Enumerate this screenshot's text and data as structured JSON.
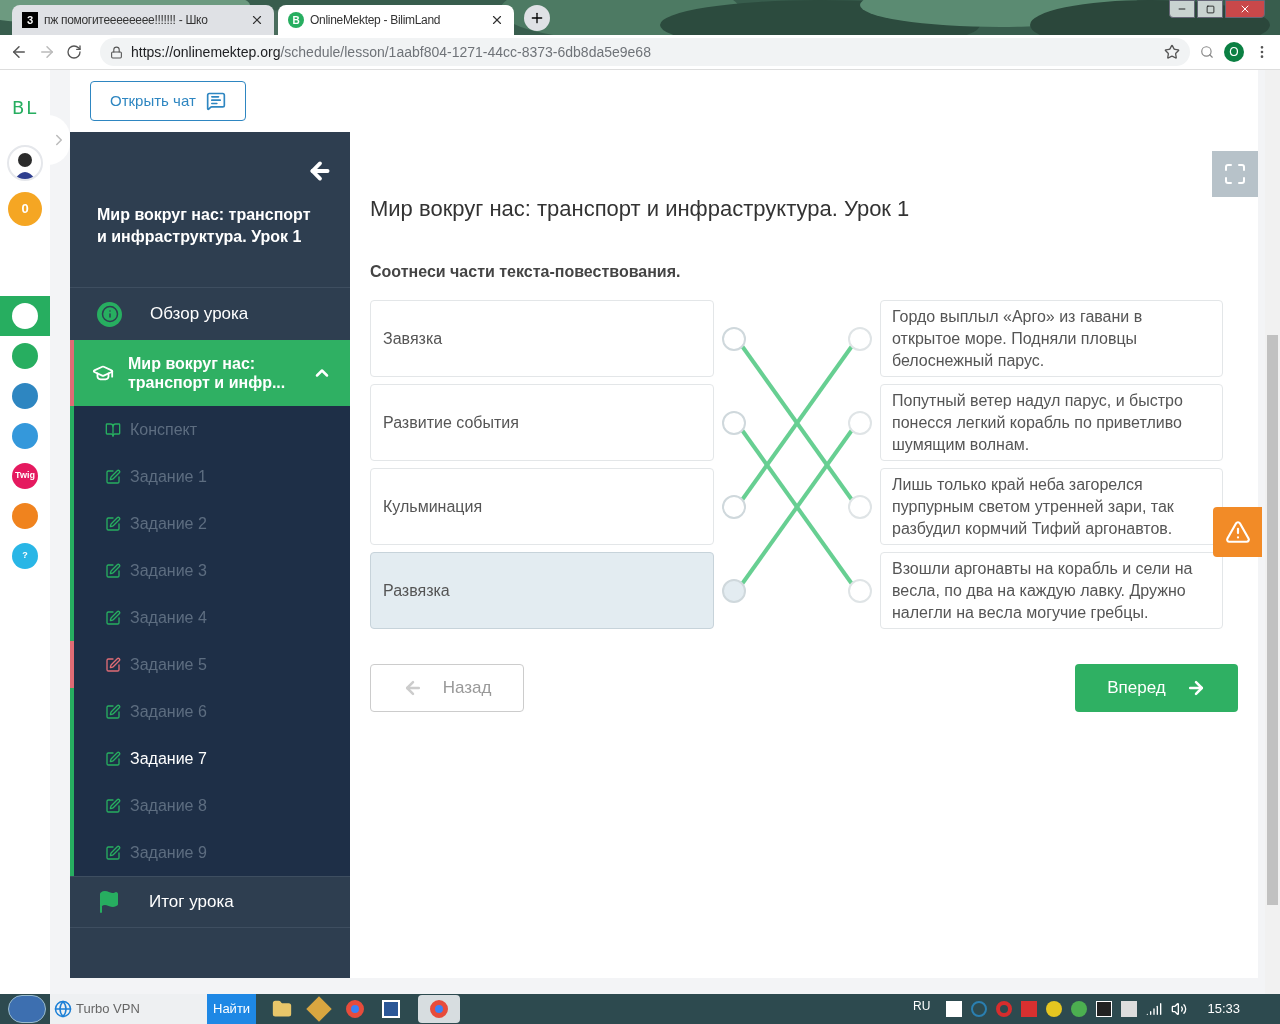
{
  "browser": {
    "tabs": [
      {
        "title": "пж помогитееееееее!!!!!!! - Шко",
        "icon": "З",
        "selected": false
      },
      {
        "title": "OnlineMektep - BilimLand",
        "icon": "B",
        "selected": true
      }
    ],
    "url_host": "https://onlinemektep.org",
    "url_path": "/schedule/lesson/1aabf804-1271-44cc-8373-6db8da5e9e68",
    "profile": "O"
  },
  "rail": {
    "logo": "BL",
    "coins": "0",
    "apps": [
      {
        "selected": true,
        "color": "#ffffff"
      },
      {
        "selected": false,
        "color": "#27ae60"
      },
      {
        "selected": false,
        "color": "#2e86c1"
      },
      {
        "selected": false,
        "color": "#3498db"
      },
      {
        "label": "Twig",
        "selected": false,
        "color": "#e5195f"
      },
      {
        "selected": false,
        "color": "#f0831e"
      },
      {
        "label": "?",
        "selected": false,
        "color": "#29b6e6"
      }
    ]
  },
  "chat_button": "Открыть чат",
  "sidebar": {
    "title": "Мир вокруг нас: транспорт и инфраструктура. Урок 1",
    "overview": "Обзор урока",
    "section": {
      "title": "Мир вокруг нас: транспорт и инфр...",
      "expanded": true
    },
    "items": [
      {
        "kind": "notes",
        "label": "Конспект",
        "correct": true,
        "selected": false
      },
      {
        "kind": "task",
        "label": "Задание 1",
        "correct": true,
        "selected": false
      },
      {
        "kind": "task",
        "label": "Задание 2",
        "correct": true,
        "selected": false
      },
      {
        "kind": "task",
        "label": "Задание 3",
        "correct": true,
        "selected": false
      },
      {
        "kind": "task",
        "label": "Задание 4",
        "correct": true,
        "selected": false
      },
      {
        "kind": "task",
        "label": "Задание 5",
        "correct": false,
        "selected": false
      },
      {
        "kind": "task",
        "label": "Задание 6",
        "correct": true,
        "selected": false
      },
      {
        "kind": "task",
        "label": "Задание 7",
        "correct": true,
        "selected": true
      },
      {
        "kind": "task",
        "label": "Задание 8",
        "correct": true,
        "selected": false
      },
      {
        "kind": "task",
        "label": "Задание 9",
        "correct": true,
        "selected": false
      }
    ],
    "summary": "Итог урока"
  },
  "lesson": {
    "title": "Мир вокруг нас: транспорт и инфраструктура. Урок 1",
    "instruction": "Соотнеси части текста-повествования.",
    "left": [
      {
        "text": "Завязка",
        "links": [
          false,
          false,
          true,
          false
        ],
        "selected": false
      },
      {
        "text": "Развитие события",
        "links": [
          false,
          false,
          false,
          true
        ],
        "selected": false
      },
      {
        "text": "Кульминация",
        "links": [
          true,
          false,
          false,
          false
        ],
        "selected": false
      },
      {
        "text": "Развязка",
        "links": [
          false,
          true,
          false,
          false
        ],
        "selected": true
      }
    ],
    "right": [
      "Гордо выплыл «Арго» из гавани в открытое море. Подняли пловцы белоснежный парус.",
      "Попутный ветер надул парус, и быстро понесся легкий корабль по приветливо шумящим волнам.",
      "Лишь только край неба загорелся пурпурным светом утренней зари, так разбудил кормчий Тифий аргонавтов.",
      "Взошли аргонавты на корабль и сели на весла, по два на каждую лавку. Дружно налегли на весла могучие гребцы."
    ],
    "back": "Назад",
    "next": "Вперед"
  },
  "taskbar": {
    "search": "Найти",
    "pinned": "Turbo VPN",
    "language": "RU",
    "clock": "15:33"
  }
}
